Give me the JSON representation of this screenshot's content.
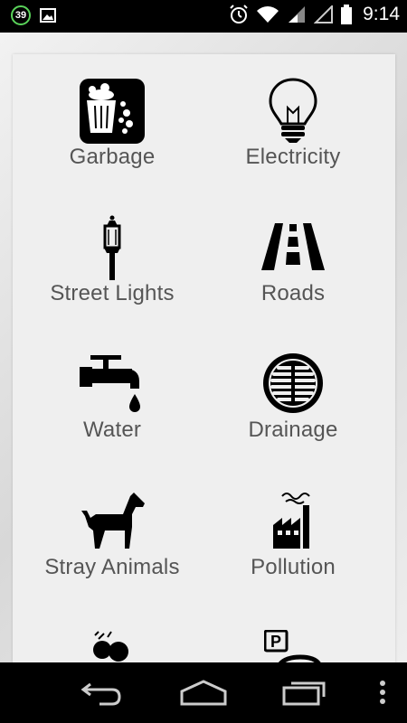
{
  "status_bar": {
    "notification_count": "39",
    "time": "9:14",
    "icons": [
      "notification-counter-icon",
      "image-icon",
      "alarm-icon",
      "wifi-icon",
      "signal-icon",
      "no-signal-icon",
      "battery-icon"
    ]
  },
  "categories": [
    {
      "label": "Garbage",
      "icon": "garbage-icon"
    },
    {
      "label": "Electricity",
      "icon": "lightbulb-icon"
    },
    {
      "label": "Street Lights",
      "icon": "street-light-icon"
    },
    {
      "label": "Roads",
      "icon": "road-icon"
    },
    {
      "label": "Water",
      "icon": "water-tap-icon"
    },
    {
      "label": "Drainage",
      "icon": "drain-icon"
    },
    {
      "label": "Stray Animals",
      "icon": "dog-icon"
    },
    {
      "label": "Pollution",
      "icon": "factory-icon"
    },
    {
      "label": "",
      "icon": "noise-icon"
    },
    {
      "label": "",
      "icon": "parking-icon"
    }
  ],
  "nav_bar": {
    "icons": [
      "back-icon",
      "home-icon",
      "recent-apps-icon",
      "overflow-menu-icon"
    ]
  },
  "colors": {
    "panel": "#efefef",
    "label": "#555555",
    "icon": "#000000",
    "status_bar": "#000000",
    "accent_green": "#5ad35a"
  }
}
